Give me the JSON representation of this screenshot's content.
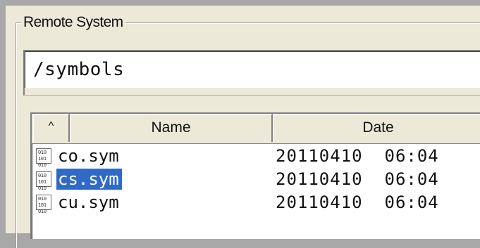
{
  "group": {
    "title": "Remote System"
  },
  "path": {
    "value": "/symbols"
  },
  "list": {
    "columns": {
      "sort": "^",
      "name": "Name",
      "date": "Date"
    },
    "rows": [
      {
        "name": "co.sym",
        "date": "20110410  06:04",
        "selected": false,
        "icon": "binary-file-icon"
      },
      {
        "name": "cs.sym",
        "date": "20110410  06:04",
        "selected": true,
        "icon": "binary-file-icon"
      },
      {
        "name": "cu.sym",
        "date": "20110410  06:04",
        "selected": false,
        "icon": "binary-file-icon"
      }
    ]
  },
  "colors": {
    "background": "#a8a8a8",
    "panel": "#ece9d8",
    "selection": "#316ac5"
  }
}
